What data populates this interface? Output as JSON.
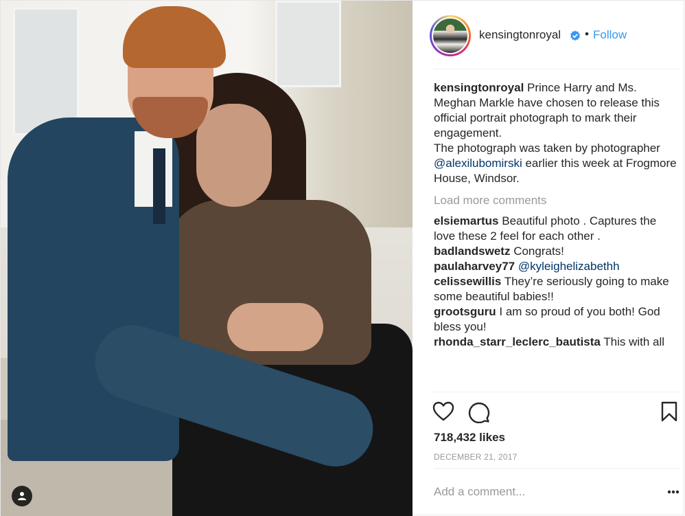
{
  "post": {
    "username": "kensingtonroyal",
    "follow_label": "Follow",
    "caption_part1": "Prince Harry and Ms. Meghan Markle have chosen to release this official portrait photograph to mark their engagement.",
    "caption_part2_prefix": "The photograph was taken by photographer ",
    "caption_mention": "@alexilubomirski",
    "caption_part2_suffix": " earlier this week at Frogmore House, Windsor.",
    "load_more_label": "Load more comments",
    "comments": [
      {
        "user": "elsiemartus",
        "text": "Beautiful photo . Captures the love these 2 feel for each other ."
      },
      {
        "user": "badlandswetz",
        "text": "Congrats!"
      },
      {
        "user": "paulaharvey77",
        "text": "@kyleighelizabethh"
      },
      {
        "user": "celissewillis",
        "text": "They’re seriously going to make some beautiful babies!!"
      },
      {
        "user": "grootsguru",
        "text": "I am so proud of you both! God bless you!"
      },
      {
        "user": "rhonda_starr_leclerc_bautista",
        "text": "This with all"
      }
    ],
    "likes_text": "718,432 likes",
    "date_text": "DECEMBER 21, 2017",
    "add_comment_placeholder": "Add a comment..."
  },
  "icons": {
    "like": "heart-outline-icon",
    "comment": "speech-bubble-icon",
    "save": "bookmark-icon",
    "more": "ellipsis-icon",
    "verified": "verified-badge-icon",
    "tagged_user": "person-icon"
  },
  "colors": {
    "link_blue": "#3897f0",
    "mention_blue": "#003569",
    "muted_gray": "#999999",
    "text": "#262626"
  }
}
